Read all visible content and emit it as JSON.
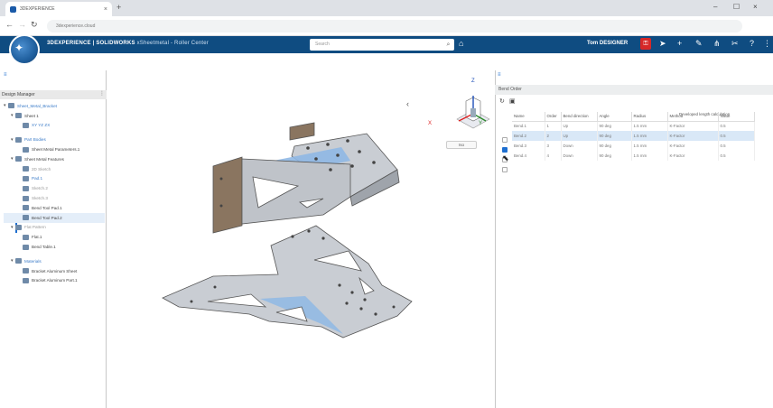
{
  "browser": {
    "tab_title": "3DEXPERIENCE",
    "tab_close": "×",
    "new_tab": "+",
    "url": "3dexperience.cloud",
    "win_min": "–",
    "win_max": "☐",
    "win_close": "×"
  },
  "app": {
    "brand_main": "3DEXPERIENCE | SOLIDWORKS",
    "brand_sub": " xSheetmetal - Roller Center",
    "search_placeholder": "Search",
    "user": "Tom DESIGNER"
  },
  "left_panel": {
    "title": "Design Manager",
    "grip": "⋮",
    "tree": [
      {
        "label": "Sheet_Metal_Bracket",
        "indent": 0,
        "exp": "▾",
        "style": "blue"
      },
      {
        "label": "Sheet 1",
        "indent": 1,
        "exp": "▾",
        "style": ""
      },
      {
        "label": "XY   YZ   ZX",
        "indent": 2,
        "exp": "",
        "style": "blue"
      },
      {
        "label": "",
        "indent": 0,
        "exp": "",
        "style": "gap"
      },
      {
        "label": "Part Bodies",
        "indent": 1,
        "exp": "▾",
        "style": "blue"
      },
      {
        "label": "Sheet Metal Parameters.1",
        "indent": 2,
        "exp": "",
        "style": ""
      },
      {
        "label": "Sheet Metal Features",
        "indent": 1,
        "exp": "▾",
        "style": ""
      },
      {
        "label": "2D Sketch",
        "indent": 2,
        "exp": "",
        "style": "grey"
      },
      {
        "label": "Pad.1",
        "indent": 2,
        "exp": "",
        "style": "blue"
      },
      {
        "label": "Sketch.2",
        "indent": 2,
        "exp": "",
        "style": "grey"
      },
      {
        "label": "Sketch.3",
        "indent": 2,
        "exp": "",
        "style": "grey"
      },
      {
        "label": "Bend Tool Pad.1",
        "indent": 2,
        "exp": "",
        "style": ""
      },
      {
        "label": "Bend Tool Pad.2",
        "indent": 2,
        "exp": "",
        "style": "sel"
      },
      {
        "label": "Flat Pattern",
        "indent": 1,
        "exp": "▾",
        "style": "grey"
      },
      {
        "label": "Flat.1",
        "indent": 2,
        "exp": "",
        "style": ""
      },
      {
        "label": "Bend Table.1",
        "indent": 2,
        "exp": "",
        "style": ""
      },
      {
        "label": "",
        "indent": 0,
        "exp": "",
        "style": "gap"
      },
      {
        "label": "Materials",
        "indent": 1,
        "exp": "▾",
        "style": "blue"
      },
      {
        "label": "Bracket Aluminum Sheet",
        "indent": 2,
        "exp": "",
        "style": ""
      },
      {
        "label": "Bracket Aluminum Part.1",
        "indent": 2,
        "exp": "",
        "style": ""
      }
    ]
  },
  "viewport": {
    "view_pill": "Iso",
    "collapse_arrow": "‹",
    "axis_x": "X",
    "axis_y": "Y",
    "axis_z": "Z"
  },
  "right_panel": {
    "tab": "≡",
    "title": "Bend Order",
    "group_header": "Developed length calculation",
    "columns": [
      "Name",
      "Order",
      "Bend direction",
      "Angle",
      "Radius",
      "Method",
      "Value"
    ],
    "rows": [
      {
        "name": "Bend.1",
        "order": "1",
        "dir": "Up",
        "angle": "90 deg",
        "radius": "1.5 mm",
        "method": "K-Factor",
        "value": "0.5",
        "selected": false
      },
      {
        "name": "Bend.2",
        "order": "2",
        "dir": "Up",
        "angle": "90 deg",
        "radius": "1.5 mm",
        "method": "K-Factor",
        "value": "0.5",
        "selected": true
      },
      {
        "name": "Bend.3",
        "order": "3",
        "dir": "Down",
        "angle": "90 deg",
        "radius": "1.5 mm",
        "method": "K-Factor",
        "value": "0.5",
        "selected": false
      },
      {
        "name": "Bend.4",
        "order": "4",
        "dir": "Down",
        "angle": "90 deg",
        "radius": "1.5 mm",
        "method": "K-Factor",
        "value": "0.5",
        "selected": false
      }
    ]
  },
  "colors": {
    "header": "#0f4c81",
    "accent": "#1e6fd0",
    "part_fill": "#c9cdd3",
    "bend_highlight": "#8fb8e4"
  }
}
